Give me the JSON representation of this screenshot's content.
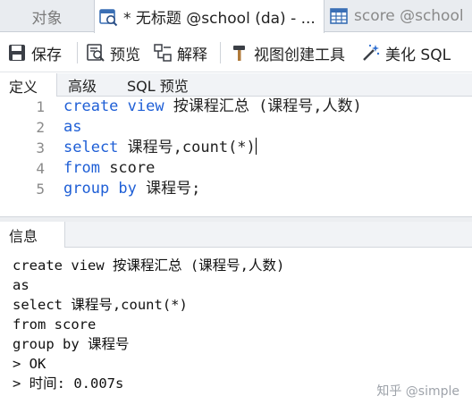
{
  "doc_tabs": [
    {
      "label": "对象"
    },
    {
      "label": "* 无标题 @school (da) - ..."
    },
    {
      "label": "score @school"
    }
  ],
  "toolbar": {
    "save": "保存",
    "preview": "预览",
    "explain": "解释",
    "view_builder": "视图创建工具",
    "beautify": "美化 SQL"
  },
  "sub_tabs": [
    "定义",
    "高级",
    "SQL 预览"
  ],
  "editor": {
    "lines": [
      {
        "num": "1",
        "kw1": "create view",
        "rest": " 按课程汇总 (课程号,人数)"
      },
      {
        "num": "2",
        "kw1": "as",
        "rest": ""
      },
      {
        "num": "3",
        "kw1": "select",
        "rest": " 课程号,count(*)"
      },
      {
        "num": "4",
        "kw1": "from",
        "rest": " score"
      },
      {
        "num": "5",
        "kw1": "group by",
        "rest": " 课程号;"
      }
    ]
  },
  "info": {
    "tab": "信息",
    "output": [
      "create view 按课程汇总 (课程号,人数)",
      "as",
      "select 课程号,count(*)",
      "from score",
      "group by 课程号",
      "> OK",
      "> 时间: 0.007s"
    ]
  },
  "watermark": "知乎 @simple",
  "colors": {
    "keyword": "#1f5fd6",
    "gutter": "#8a8a8a",
    "tab_bar": "#e9ecf0"
  }
}
